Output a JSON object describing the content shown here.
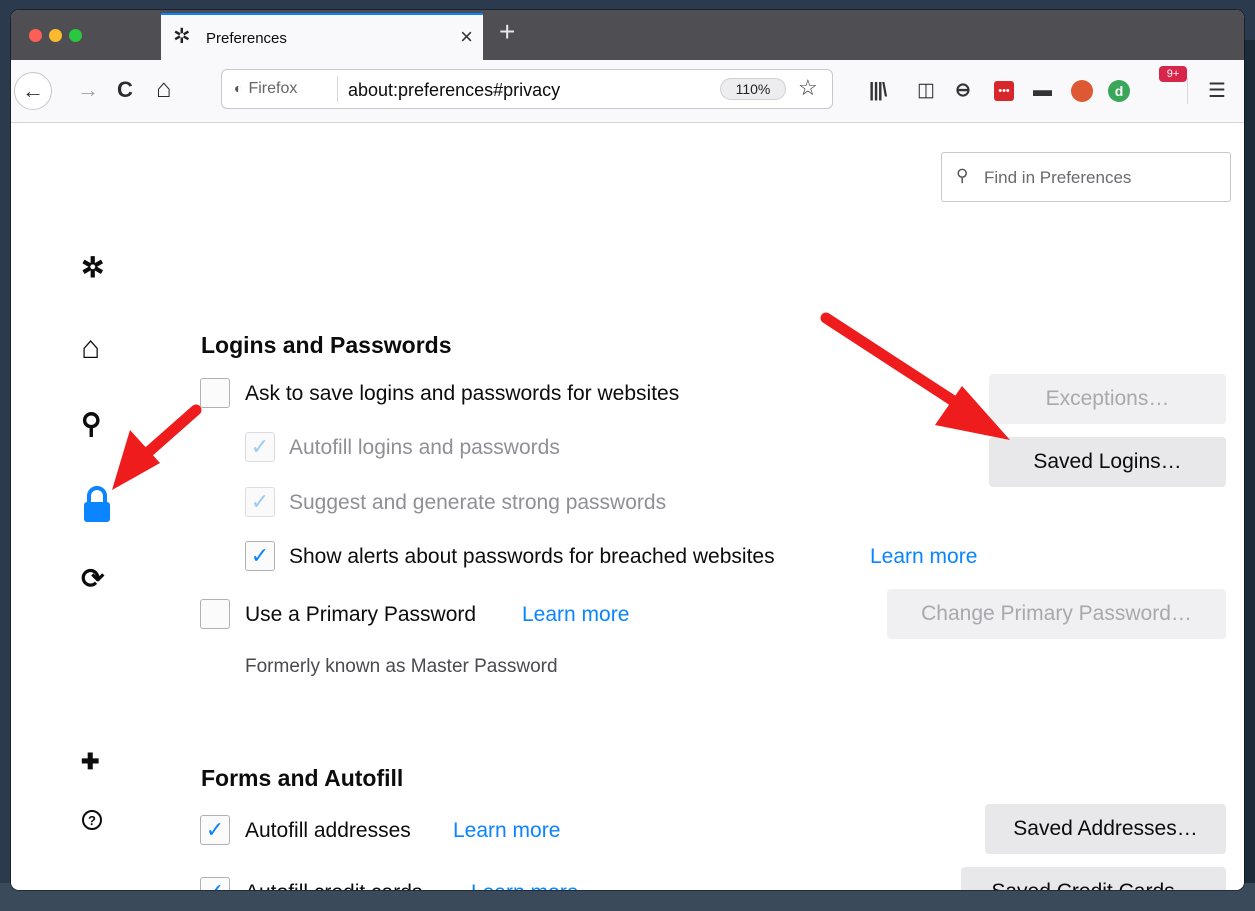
{
  "window": {
    "tab_title": "Preferences",
    "tab_close": "×",
    "new_tab": "+"
  },
  "navbar": {
    "back": "←",
    "forward": "→",
    "reload": "C",
    "home": "⌂",
    "identity_label": "Firefox",
    "url": "about:preferences#privacy",
    "zoom": "110%",
    "bookmark": "☆",
    "extension_badge": "9+",
    "menu": "☰"
  },
  "search": {
    "placeholder": "Find in Preferences"
  },
  "categories": [
    {
      "name": "general",
      "icon": "gear-icon",
      "glyph": "✲"
    },
    {
      "name": "home",
      "icon": "home-icon",
      "glyph": "⌂"
    },
    {
      "name": "search",
      "icon": "search-icon",
      "glyph": "⚲"
    },
    {
      "name": "privacy",
      "icon": "lock-icon",
      "glyph": "🔒",
      "selected": true
    },
    {
      "name": "sync",
      "icon": "sync-icon",
      "glyph": "⟳"
    },
    {
      "name": "extensions",
      "icon": "puzzle-icon",
      "glyph": "✚"
    },
    {
      "name": "support",
      "icon": "help-icon",
      "glyph": "?"
    }
  ],
  "logins": {
    "title": "Logins and Passwords",
    "ask_save": {
      "label": "Ask to save logins and passwords for websites",
      "checked": false
    },
    "autofill": {
      "label": "Autofill logins and passwords",
      "checked": true,
      "disabled": true
    },
    "suggest": {
      "label": "Suggest and generate strong passwords",
      "checked": true,
      "disabled": true
    },
    "breach_alerts": {
      "label": "Show alerts about passwords for breached websites",
      "checked": true,
      "learn_more": "Learn more"
    },
    "primary_password": {
      "label": "Use a Primary Password",
      "checked": false,
      "learn_more": "Learn more"
    },
    "primary_hint": "Formerly known as Master Password",
    "exceptions_button": "Exceptions…",
    "saved_logins_button": "Saved Logins…",
    "change_primary_button": "Change Primary Password…"
  },
  "forms": {
    "title": "Forms and Autofill",
    "autofill_addresses": {
      "label": "Autofill addresses",
      "checked": true,
      "learn_more": "Learn more"
    },
    "autofill_cards": {
      "label": "Autofill credit cards",
      "checked": true,
      "learn_more": "Learn more"
    },
    "saved_addresses_button": "Saved Addresses…",
    "saved_cards_button": "Saved Credit Cards…"
  },
  "colors": {
    "accent": "#0a84ff",
    "annotation_arrow": "#ee1c1c"
  }
}
